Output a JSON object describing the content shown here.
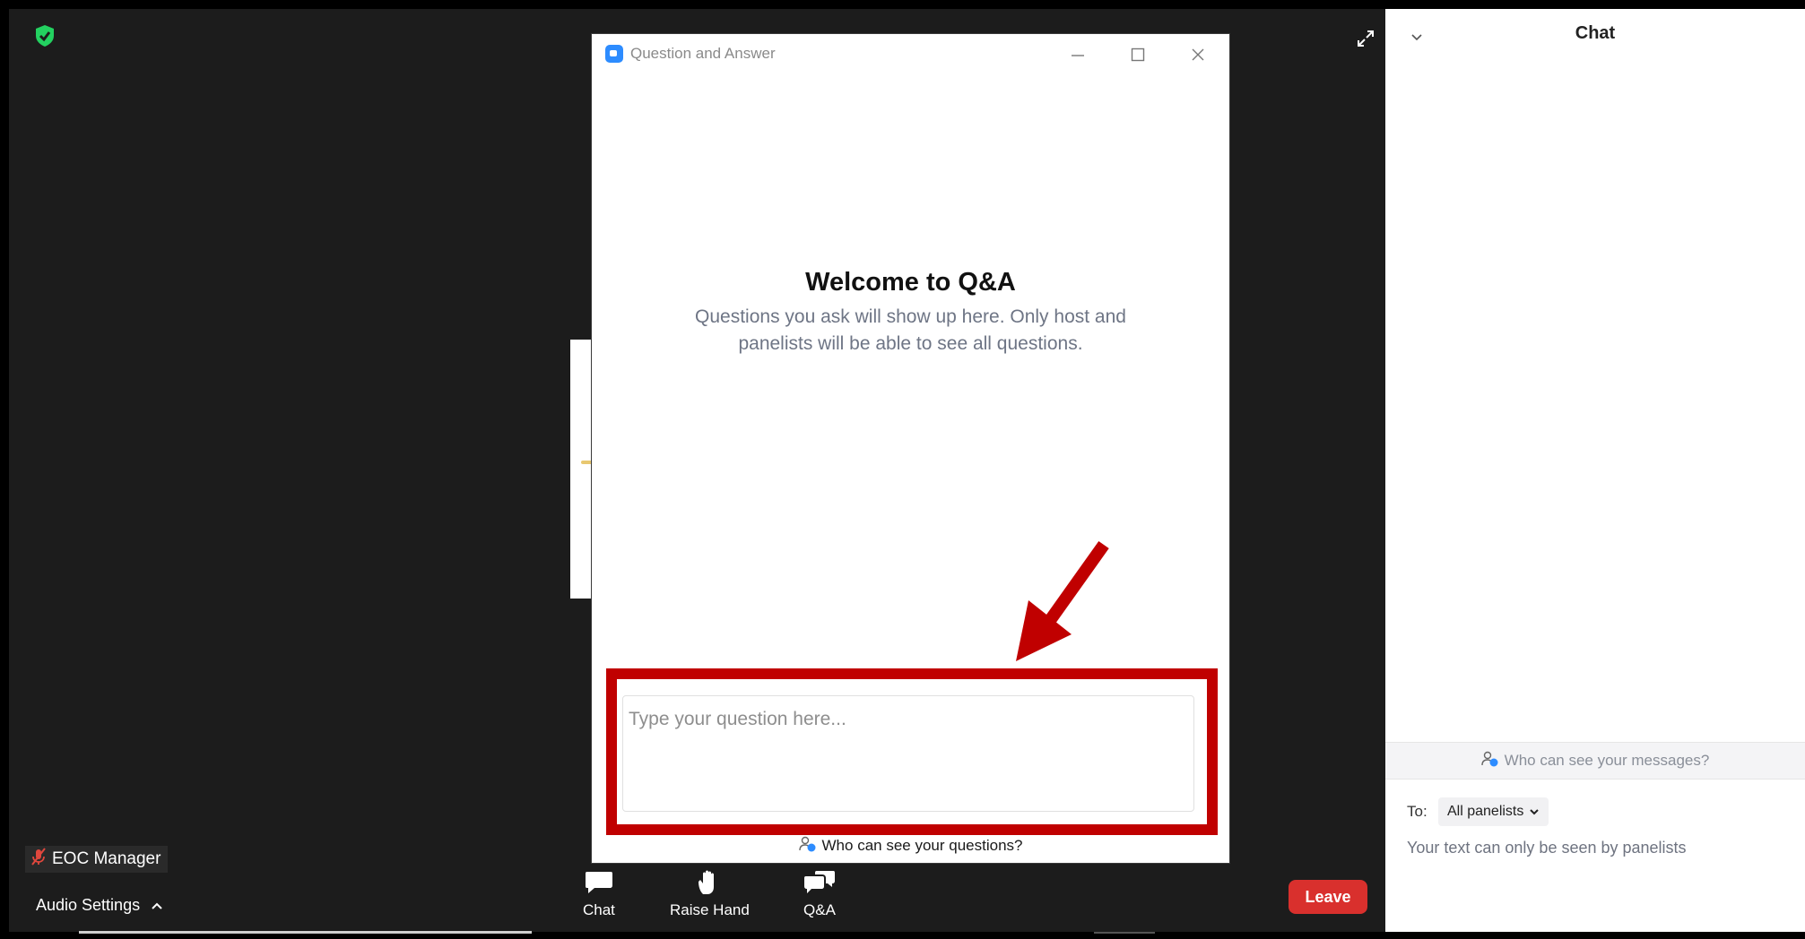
{
  "qa_window": {
    "title": "Question and Answer",
    "welcome_title": "Welcome to Q&A",
    "welcome_text": "Questions you ask will show up here. Only host and panelists will be able to see all questions.",
    "input_placeholder": "Type your question here...",
    "who_can_see": "Who can see your questions?"
  },
  "participant": {
    "name": "EOC Manager"
  },
  "audio": {
    "label": "Audio Settings"
  },
  "toolbar": {
    "chat_label": "Chat",
    "raise_hand_label": "Raise Hand",
    "qa_label": "Q&A",
    "leave_label": "Leave"
  },
  "chat": {
    "title": "Chat",
    "who_can_see": "Who can see your messages?",
    "to_label": "To:",
    "recipient": "All panelists",
    "note": "Your text can only be seen by panelists"
  },
  "colors": {
    "leave_red": "#d9302d",
    "annotation_red": "#c00000",
    "zoom_blue": "#2d8cff",
    "shield_green": "#23d160"
  },
  "icons": [
    "shield-check-icon",
    "expand-icon",
    "zoom-app-icon",
    "minimize-icon",
    "maximize-icon",
    "close-icon",
    "muted-mic-icon",
    "chevron-up-icon",
    "chat-bubble-icon",
    "hand-icon",
    "qa-bubbles-icon",
    "chevron-down-icon",
    "people-info-icon"
  ]
}
